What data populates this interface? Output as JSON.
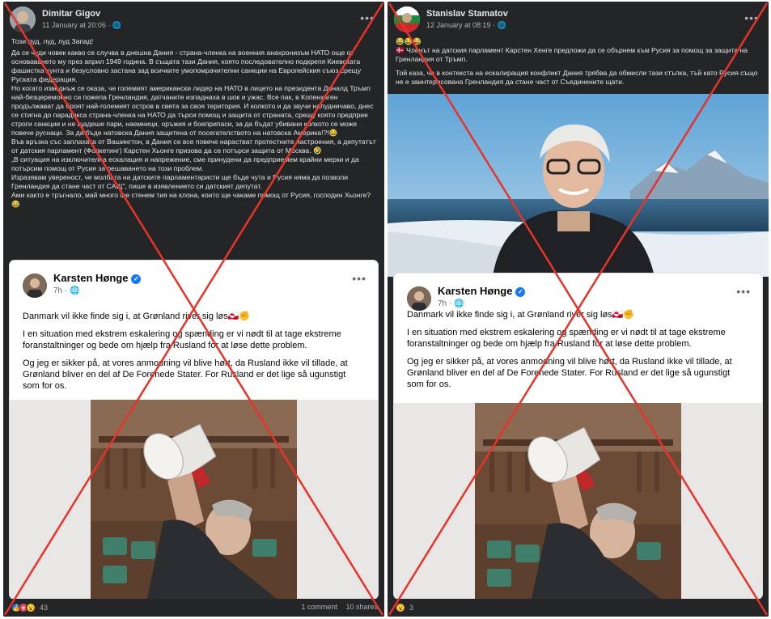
{
  "left_post": {
    "author": "Dimitar Gigov",
    "meta": "11 January at 20:06 · ",
    "paragraphs": [
      "Този луд, луд, луд Запад!",
      "Да се чуди човек какво се случва в днешна Дания - страна-членка на военния анахронизъм НАТО още от основаването му през април 1949 година. В същата тази Дания, която последователно подкрепя Киевската фашистка хунта и безусловно застана зад всичките умопомрачителни санкции на Европейския съюз срещу Руската федерация.",
      "Но когато изведнъж се оказа, че големият американски лидер на НАТО в лицето на президента Доналд Тръмп най-безцеремонно си пожела Гренландия, датчаните изпаднаха в шок и ужас. Все пак, в Копенхаген продължават да броят най-големият остров в света за своя територия. И колкото и да звучи налудничаво, днес се стигна до парадокса страна-членка на НАТО да търси помощ и защита от страната, срещу която предприе строги санкции и не щадеше пари, наемници, оръжия и боеприпаси, за да бъдат убивани колкото се може повече руснаци. За да бъде натовска Дания защитена от посегателството на натовска Америка!?!😂",
      "Във връзка със заплахата от Вашингтон, в Дания се все повече нарастват протестните настроения, а депутатът от датския парламент (Фолкетинг) Карстен Хьонге призова да се потърси защита от Москва. 🤣",
      "„В ситуация на изключителна ескалация и напрежение, сме принудени да предприемем крайни мерки и да потърсим помощ от Русия за решаването на този проблем.",
      "Изразявам увереност, че молбата на датските парламентаристи ще бъде чута и Русия няма да позволи Гренландия да стане част от САЩ\", пише в изявлението си датският депутат.",
      "Ами както е тръгнало, май много ще стенем тия на клона, които ще чакаме помощ от Русия, господин Хьонге?😂"
    ],
    "reactions_count": "43",
    "comments": "1 comment",
    "shares": "10 shares"
  },
  "right_post": {
    "author": "Stanislav Stamatov",
    "meta": "12 January at 08:19 · ",
    "emoji_line": "😂😂😂",
    "paragraphs": [
      "🇩🇰 Членът на датския парламент Карстен Хенге предложи да се обърнем към Русия за помощ за защита на Гренландия от Тръмп.",
      "Той каза, че в контекста на ескалиращия конфликт Дания трябва да обмисли тази стъпка, тъй като Русия също не е заинтересована Гренландия да стане част от Съединените щати."
    ],
    "reactions_count": "3"
  },
  "shared_post": {
    "author": "Karsten Hønge",
    "time": "7h · ",
    "paragraphs": [
      "Danmark vil ikke finde sig i, at Grønland river sig løs🇬🇱✊",
      "I en situation med ekstrem eskalering og spænding er vi nødt til at tage ekstreme foranstaltninger og bede om hjælp fra Rusland for at løse dette problem.",
      "Og jeg er sikker på, at vores anmodning vil blive hørt, da Rusland ikke vil tillade, at Grønland bliver en del af De Forenede Stater. For Rusland er det lige så ugunstigt som for os."
    ]
  },
  "icons": {
    "more": "more-options-icon",
    "verified": "verified-badge-icon",
    "globe": "globe-icon",
    "like": "like-reaction-icon",
    "heart": "love-reaction-icon",
    "wow": "wow-reaction-icon"
  },
  "colors": {
    "post_bg": "#242526",
    "cross": "#e8332a",
    "verified": "#1877f2"
  }
}
